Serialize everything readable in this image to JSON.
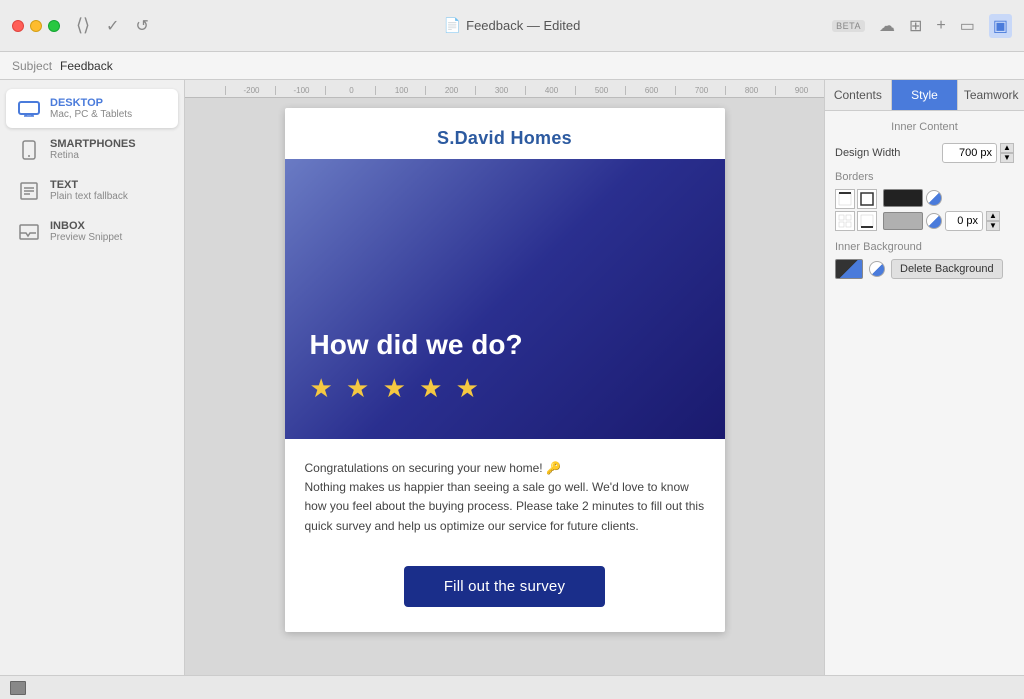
{
  "app": {
    "beta_label": "BETA",
    "title": "Feedback — Edited",
    "subject_label": "Subject",
    "subject_value": "Feedback"
  },
  "sidebar": {
    "items": [
      {
        "id": "desktop",
        "title": "DESKTOP",
        "subtitle": "Mac, PC & Tablets",
        "active": true
      },
      {
        "id": "smartphones",
        "title": "SMARTPHONES",
        "subtitle": "Retina",
        "active": false
      },
      {
        "id": "text",
        "title": "TEXT",
        "subtitle": "Plain text fallback",
        "active": false
      },
      {
        "id": "inbox",
        "title": "INBOX",
        "subtitle": "Preview Snippet",
        "active": false
      }
    ]
  },
  "email": {
    "sender": "S.David Homes",
    "hero": {
      "title": "How did we do?",
      "stars": "★ ★ ★ ★ ★"
    },
    "body_text": "Congratulations on securing your new home! 🔑\nNothing makes us happier than seeing a sale go well. We'd love to know how you feel about the buying process. Please take 2 minutes to fill out this quick survey and help us optimize our service for future clients.",
    "cta_label": "Fill out the survey"
  },
  "right_panel": {
    "tabs": [
      {
        "id": "contents",
        "label": "Contents",
        "active": false
      },
      {
        "id": "style",
        "label": "Style",
        "active": true
      },
      {
        "id": "teamwork",
        "label": "Teamwork",
        "active": false
      }
    ],
    "inner_content": {
      "section_title": "Inner Content",
      "design_width_label": "Design Width",
      "design_width_value": "700 px"
    },
    "borders": {
      "section_title": "Borders",
      "width_value": "0 px"
    },
    "inner_background": {
      "section_title": "Inner Background",
      "delete_bg_label": "Delete Background"
    }
  },
  "ruler": {
    "marks": [
      "-200",
      "-100",
      "0",
      "100",
      "200",
      "300",
      "400",
      "500",
      "600",
      "700",
      "800",
      "900"
    ]
  }
}
